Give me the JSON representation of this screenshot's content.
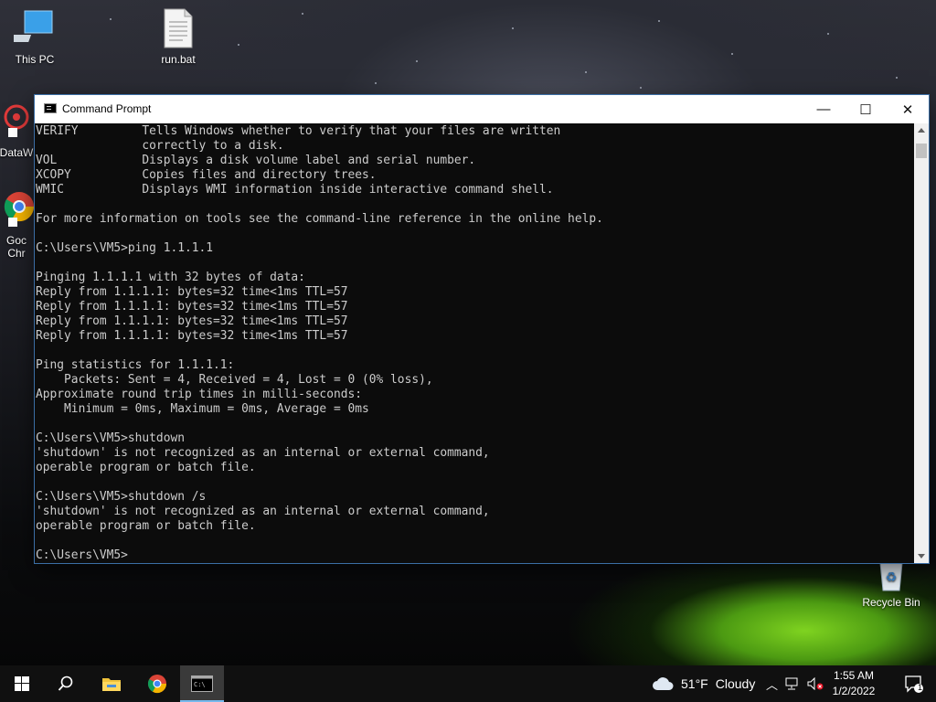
{
  "desktop": {
    "icons": [
      {
        "label": "This PC",
        "icon": "computer-icon"
      },
      {
        "label": "run.bat",
        "icon": "batch-file-icon"
      },
      {
        "label": "DataW",
        "icon": "datawrapper-icon"
      },
      {
        "label": "Goc\nChr",
        "icon": "chrome-icon"
      },
      {
        "label": "Recycle Bin",
        "icon": "recycle-bin-icon"
      }
    ]
  },
  "window": {
    "title": "Command Prompt",
    "controls": {
      "minimize": "—",
      "maximize": "☐",
      "close": "✕"
    },
    "terminal_text": "VERIFY         Tells Windows whether to verify that your files are written\n               correctly to a disk.\nVOL            Displays a disk volume label and serial number.\nXCOPY          Copies files and directory trees.\nWMIC           Displays WMI information inside interactive command shell.\n\nFor more information on tools see the command-line reference in the online help.\n\nC:\\Users\\VM5>ping 1.1.1.1\n\nPinging 1.1.1.1 with 32 bytes of data:\nReply from 1.1.1.1: bytes=32 time<1ms TTL=57\nReply from 1.1.1.1: bytes=32 time<1ms TTL=57\nReply from 1.1.1.1: bytes=32 time<1ms TTL=57\nReply from 1.1.1.1: bytes=32 time<1ms TTL=57\n\nPing statistics for 1.1.1.1:\n    Packets: Sent = 4, Received = 4, Lost = 0 (0% loss),\nApproximate round trip times in milli-seconds:\n    Minimum = 0ms, Maximum = 0ms, Average = 0ms\n\nC:\\Users\\VM5>shutdown\n'shutdown' is not recognized as an internal or external command,\noperable program or batch file.\n\nC:\\Users\\VM5>shutdown /s\n'shutdown' is not recognized as an internal or external command,\noperable program or batch file.\n\nC:\\Users\\VM5>"
  },
  "taskbar": {
    "weather": {
      "temp": "51°F",
      "condition": "Cloudy"
    },
    "clock": {
      "time": "1:55 AM",
      "date": "1/2/2022"
    },
    "notification_count": "1",
    "accent": "#76b9ed"
  }
}
